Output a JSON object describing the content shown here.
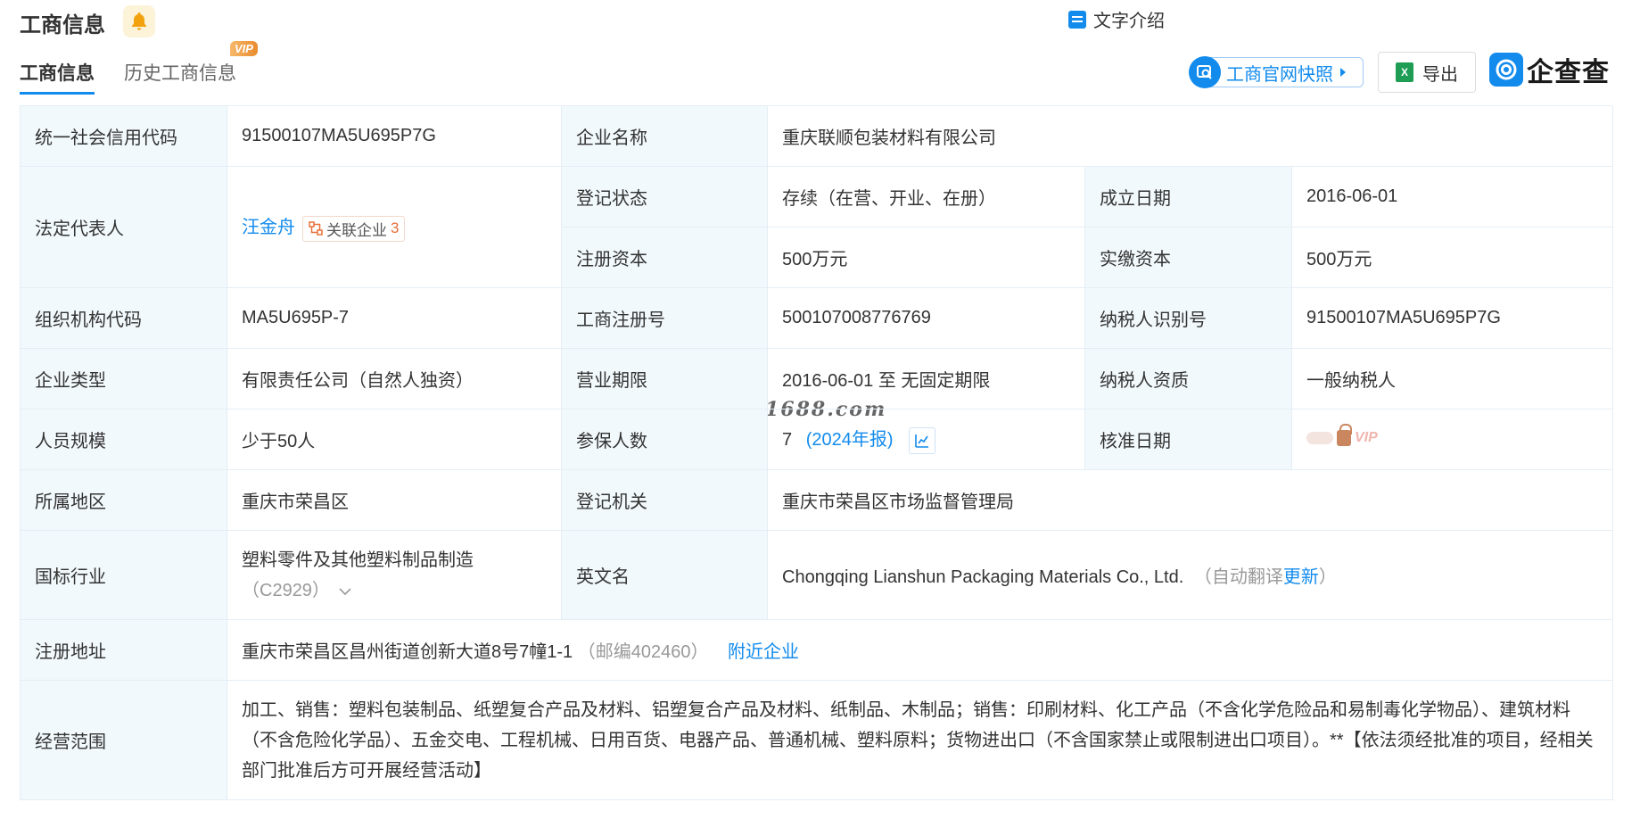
{
  "section": {
    "title": "工商信息"
  },
  "tabs": [
    {
      "label": "工商信息"
    },
    {
      "label": "历史工商信息",
      "badge": "VIP"
    }
  ],
  "toolbar": {
    "text_intro": "文字介绍",
    "snapshot": "工商官网快照",
    "export": "导出",
    "brand": "企查查"
  },
  "watermark": "1688.com",
  "rows": {
    "credit_code": {
      "label": "统一社会信用代码",
      "value": "91500107MA5U695P7G"
    },
    "company_name": {
      "label": "企业名称",
      "value": "重庆联顺包装材料有限公司"
    },
    "legal_rep": {
      "label": "法定代表人",
      "value": "汪金舟",
      "related_label": "关联企业",
      "related_count": "3"
    },
    "reg_status": {
      "label": "登记状态",
      "value": "存续（在营、开业、在册）"
    },
    "found_date": {
      "label": "成立日期",
      "value": "2016-06-01"
    },
    "reg_capital": {
      "label": "注册资本",
      "value": "500万元"
    },
    "paid_capital": {
      "label": "实缴资本",
      "value": "500万元"
    },
    "org_code": {
      "label": "组织机构代码",
      "value": "MA5U695P-7"
    },
    "reg_no": {
      "label": "工商注册号",
      "value": "500107008776769"
    },
    "taxpayer_id": {
      "label": "纳税人识别号",
      "value": "91500107MA5U695P7G"
    },
    "company_type": {
      "label": "企业类型",
      "value": "有限责任公司（自然人独资）"
    },
    "biz_term": {
      "label": "营业期限",
      "value": "2016-06-01 至 无固定期限"
    },
    "taxpayer_qual": {
      "label": "纳税人资质",
      "value": "一般纳税人"
    },
    "staff_size": {
      "label": "人员规模",
      "value": "少于50人"
    },
    "insured": {
      "label": "参保人数",
      "value": "7",
      "report": "(2024年报)"
    },
    "approval_date": {
      "label": "核准日期",
      "locked": "VIP"
    },
    "region": {
      "label": "所属地区",
      "value": "重庆市荣昌区"
    },
    "reg_authority": {
      "label": "登记机关",
      "value": "重庆市荣昌区市场监督管理局"
    },
    "industry": {
      "label": "国标行业",
      "value": "塑料零件及其他塑料制品制造",
      "code": "（C2929）"
    },
    "english_name": {
      "label": "英文名",
      "value": "Chongqing Lianshun Packaging Materials Co., Ltd.",
      "auto_prefix": "（自动翻译",
      "update": "更新",
      "auto_suffix": "）"
    },
    "reg_address": {
      "label": "注册地址",
      "value": "重庆市荣昌区昌州街道创新大道8号7幢1-1",
      "postcode": "（邮编402460）",
      "nearby": "附近企业"
    },
    "biz_scope": {
      "label": "经营范围",
      "value": "加工、销售：塑料包装制品、纸塑复合产品及材料、铝塑复合产品及材料、纸制品、木制品；销售：印刷材料、化工产品（不含化学危险品和易制毒化学物品）、建筑材料（不含危险化学品）、五金交电、工程机械、日用百货、电器产品、普通机械、塑料原料；货物进出口（不含国家禁止或限制进出口项目）。**【依法须经批准的项目，经相关部门批准后方可开展经营活动】"
    }
  },
  "colors": {
    "accent": "#128bed",
    "label_bg": "#f2f9fc",
    "border": "#e4eef6"
  }
}
